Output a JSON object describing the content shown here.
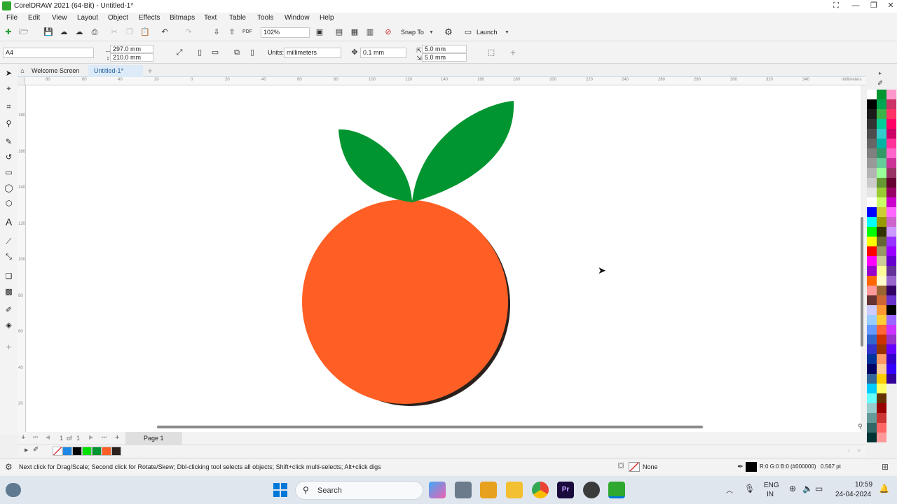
{
  "window": {
    "title": "CorelDRAW 2021 (64-Bit) - Untitled-1*"
  },
  "menu": [
    "File",
    "Edit",
    "View",
    "Layout",
    "Object",
    "Effects",
    "Bitmaps",
    "Text",
    "Table",
    "Tools",
    "Window",
    "Help"
  ],
  "toolbar": {
    "zoom": "102%",
    "snap_to": "Snap To",
    "launch": "Launch"
  },
  "property_bar": {
    "page_size": "A4",
    "width": "297.0 mm",
    "height": "210.0 mm",
    "units_label": "Units:",
    "units": "millimeters",
    "nudge": "0.1 mm",
    "dup_x": "5.0 mm",
    "dup_y": "5.0 mm"
  },
  "tabs": [
    {
      "label": "Welcome Screen",
      "active": false
    },
    {
      "label": "Untitled-1*",
      "active": true
    }
  ],
  "rulers": {
    "h_labels": [
      "80",
      "60",
      "40",
      "20",
      "0",
      "20",
      "40",
      "60",
      "80",
      "100",
      "120",
      "140",
      "160",
      "180",
      "200",
      "220",
      "240",
      "260",
      "280",
      "300",
      "320",
      "340"
    ],
    "h_unit": "millimeters",
    "v_labels": [
      "180",
      "160",
      "140",
      "120",
      "100",
      "80",
      "60",
      "40",
      "20"
    ],
    "v_unit": "millimeters"
  },
  "pages": {
    "current": "1",
    "of_label": "of",
    "total": "1",
    "page_tab": "Page 1"
  },
  "status": {
    "hint": "Next click for Drag/Scale; Second click for Rotate/Skew; Dbl-clicking tool selects all objects; Shift+click multi-selects; Alt+click digs",
    "fill": "None",
    "outline_color": "R:0 G:0 B:0 (#000000)",
    "outline_width": "0.567 pt"
  },
  "taskbar": {
    "search": "Search",
    "lang_top": "ENG",
    "lang_bottom": "IN",
    "time": "10:59",
    "date": "24-04-2024"
  },
  "colors": {
    "leaf": "#009530",
    "orange": "#ff5f24",
    "shadow": "#2a201c",
    "accent": "#0078d7"
  },
  "document_palette": [
    "#ffffff",
    "#1e88e5",
    "#000000",
    "#00e000",
    "#009530",
    "#ff5f24",
    "#2a201c"
  ],
  "palette_columns": [
    [
      "#ffffff",
      "#000000",
      "#1a1a1a",
      "#333333",
      "#4d4d4d",
      "#666666",
      "#808080",
      "#999999",
      "#b3b3b3",
      "#cccccc",
      "#e6e6e6",
      "#ffffff",
      "#0000ff",
      "#00ffff",
      "#00ff00",
      "#ffff00",
      "#ff0000",
      "#ff00ff",
      "#9900cc",
      "#ff6600",
      "#ff9999",
      "#663333",
      "#ccccff",
      "#99ccff",
      "#6699ff",
      "#3366cc",
      "#3333cc",
      "#003399",
      "#000066",
      "#336699",
      "#00ccff",
      "#66ffff",
      "#99cccc",
      "#669999",
      "#336666",
      "#003333"
    ],
    [
      "#009530",
      "#00a651",
      "#39b54a",
      "#00cc99",
      "#33cccc",
      "#00b3a4",
      "#339966",
      "#66cc99",
      "#99ff99",
      "#669933",
      "#99cc33",
      "#ccff66",
      "#cccc33",
      "#999900",
      "#333300",
      "#666633",
      "#999966",
      "#cccc99",
      "#ffff99",
      "#ffffcc",
      "#996633",
      "#cc6633",
      "#ff9933",
      "#ffcc33",
      "#ff6633",
      "#cc3300",
      "#993300",
      "#ff9966",
      "#ffcc99",
      "#ffcc00",
      "#ffff66",
      "#663300",
      "#990000",
      "#cc3333",
      "#ff6666",
      "#ff9999"
    ],
    [
      "#ff99cc",
      "#cc3366",
      "#ff3366",
      "#ff0066",
      "#cc0066",
      "#ff3399",
      "#ff66cc",
      "#cc3399",
      "#993366",
      "#660033",
      "#990066",
      "#cc00cc",
      "#ff66ff",
      "#cc66cc",
      "#cc99ff",
      "#9933ff",
      "#9900ff",
      "#6600cc",
      "#663399",
      "#9966cc",
      "#330066",
      "#6633cc",
      "#000000",
      "#9966ff",
      "#cc33ff",
      "#9933cc",
      "#6600ff",
      "#3300cc",
      "#3300ff",
      "#330099"
    ]
  ]
}
